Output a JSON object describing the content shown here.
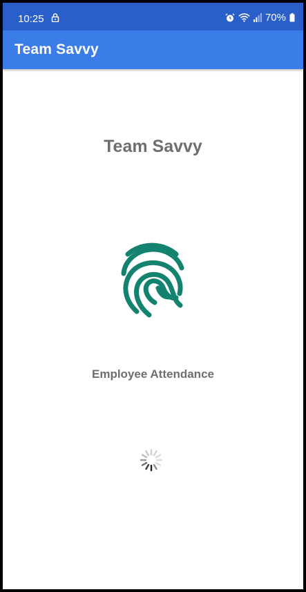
{
  "status_bar": {
    "time": "10:25",
    "battery": "70%",
    "icons": [
      "lock-icon",
      "alarm-icon",
      "wifi-icon",
      "signal-icon",
      "battery-icon"
    ]
  },
  "app_bar": {
    "title": "Team Savvy"
  },
  "splash": {
    "title": "Team Savvy",
    "icon": "fingerprint-icon",
    "subtitle": "Employee Attendance",
    "loading_indicator": "spinner-icon"
  },
  "colors": {
    "status_bar": "#2a5ec9",
    "app_bar": "#3a7ce8",
    "fingerprint": "#13826f",
    "text_gray": "#6e6e6e"
  }
}
